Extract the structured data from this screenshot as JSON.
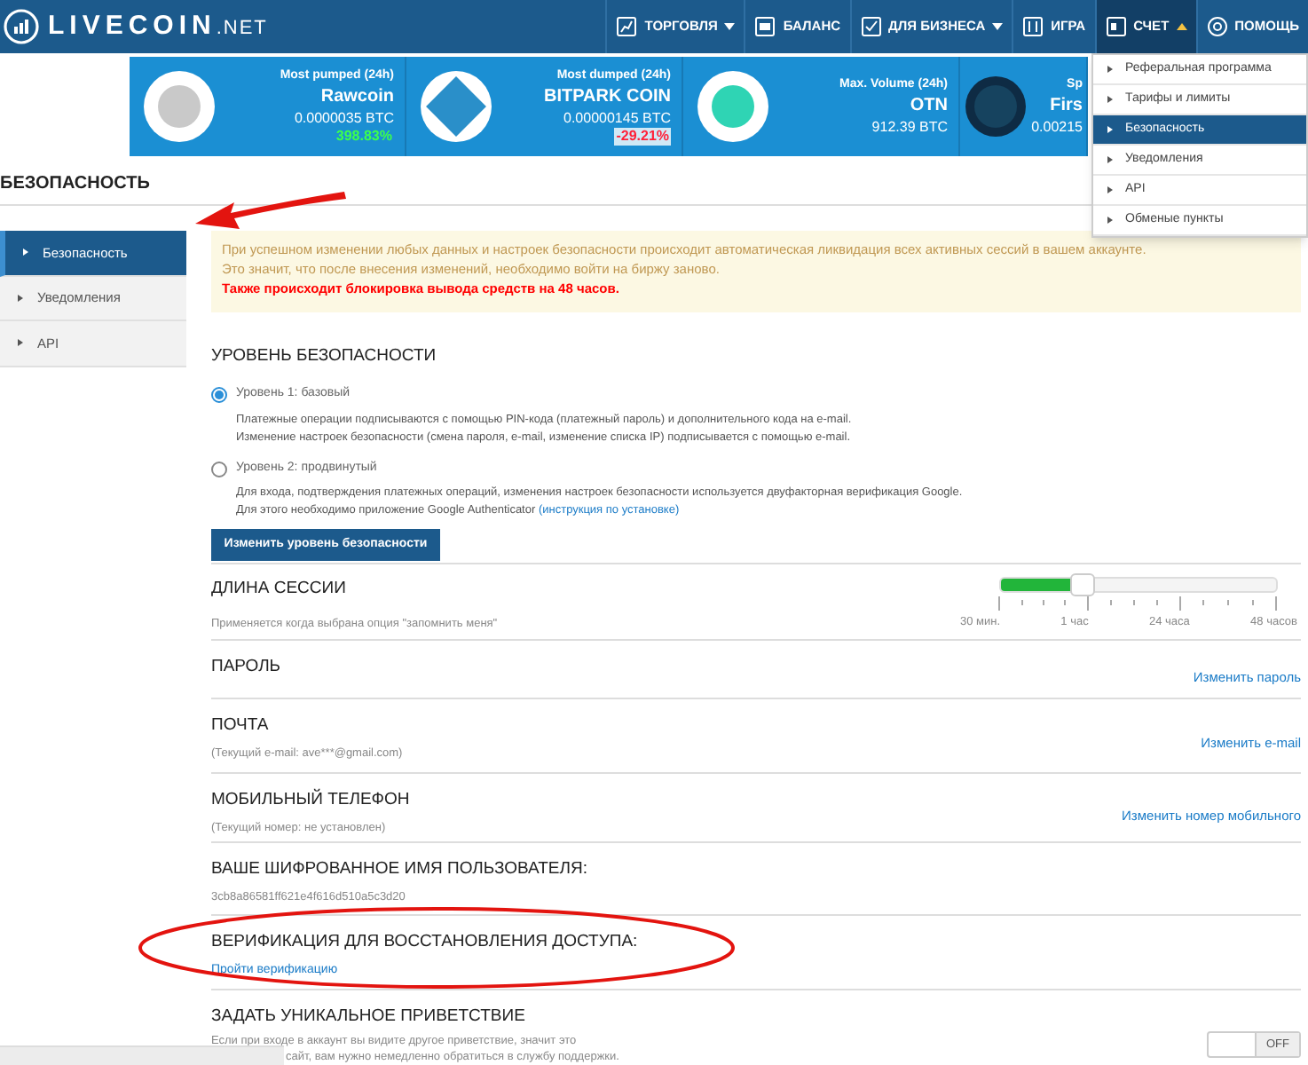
{
  "header": {
    "logo": "LIVECOIN",
    "logo_suffix": ".NET",
    "nav": [
      {
        "label": "ТОРГОВЛЯ",
        "caret": true,
        "selected": false
      },
      {
        "label": "БАЛАНС",
        "caret": false,
        "selected": false
      },
      {
        "label": "ДЛЯ БИЗНЕСА",
        "caret": true,
        "selected": false
      },
      {
        "label": "ИГРА",
        "caret": false,
        "selected": false
      },
      {
        "label": "СЧЕТ",
        "caret": true,
        "selected": true
      },
      {
        "label": "ПОМОЩЬ",
        "caret": false,
        "selected": false
      }
    ]
  },
  "tickers": [
    {
      "title": "Most pumped (24h)",
      "name": "Rawcoin",
      "price": "0.0000035 BTC",
      "change": "398.83%",
      "rising": true
    },
    {
      "title": "Most dumped (24h)",
      "name": "BITPARK COIN",
      "price": "0.00000145 BTC",
      "change": "-29.21%",
      "rising": false
    },
    {
      "title": "Max. Volume (24h)",
      "name": "OTN",
      "price": "912.39 BTC"
    },
    {
      "title": "Sp",
      "name": "Firs",
      "price": "0.00215"
    }
  ],
  "dropdown": {
    "items": [
      {
        "label": "Реферальная программа",
        "selected": false
      },
      {
        "label": "Тарифы и лимиты",
        "selected": false
      },
      {
        "label": "Безопасность",
        "selected": true
      },
      {
        "label": "Уведомления",
        "selected": false
      },
      {
        "label": "API",
        "selected": false
      },
      {
        "label": "Обменые пункты",
        "selected": false
      }
    ]
  },
  "page_title": "БЕЗОПАСНОСТЬ",
  "annotation_arrow": true,
  "sidebar": {
    "items": [
      {
        "label": "Безопасность",
        "selected": true
      },
      {
        "label": "Уведомления",
        "selected": false
      },
      {
        "label": "API",
        "selected": false
      }
    ]
  },
  "notice": {
    "lines": [
      "При успешном изменении любых данных и настроек безопасности происходит автоматическая ликвидация всех активных сессий в вашем аккаунте.",
      "Это значит, что после внесения изменений, необходимо войти на биржу заново."
    ],
    "warning": "Также происходит блокировка вывода средств на 48 часов."
  },
  "security_level": {
    "heading": "УРОВЕНЬ БЕЗОПАСНОСТИ",
    "options": [
      {
        "label": "Уровень 1: базовый",
        "selected": true,
        "lines": [
          "Платежные операции подписываются с помощью PIN-кода (платежный пароль) и дополнительного кода на e-mail.",
          "Изменение настроек безопасности (смена пароля, e-mail, изменение списка IP) подписывается с помощью e-mail."
        ]
      },
      {
        "label": "Уровень 2: продвинутый",
        "selected": false,
        "lines": [
          "Для входа, подтверждения платежных операций, изменения настроек безопасности используется двуфакторная верификация Google.",
          "Для этого необходимо приложение Google Authenticator"
        ],
        "link": "(инструкция по установке)"
      }
    ],
    "button": "Изменить уровень безопасности"
  },
  "session": {
    "heading": "ДЛИНА СЕССИИ",
    "subtitle": "Применяется когда выбрана опция \"запомнить меня\"",
    "level": 0.3,
    "ticks": [
      "30 мин.",
      "1 час",
      "24 часа",
      "48 часов"
    ]
  },
  "rows": [
    {
      "kind": "link",
      "heading": "ПАРОЛЬ",
      "action": "Изменить пароль"
    },
    {
      "kind": "link",
      "heading": "ПОЧТА",
      "subtitle": "(Текущий e-mail: ave***@gmail.com)",
      "action": "Изменить e-mail"
    },
    {
      "kind": "link",
      "heading": "МОБИЛЬНЫЙ ТЕЛЕФОН",
      "subtitle": "(Текущий номер: не установлен)",
      "action": "Изменить номер мобильного"
    },
    {
      "kind": "text",
      "heading": "ВАШЕ ШИФРОВАННОЕ ИМЯ ПОЛЬЗОВАТЕЛЯ:",
      "subtitle": "3cb8a86581ff621e4f616d510a5c3d20"
    },
    {
      "kind": "sublink",
      "heading": "ВЕРИФИКАЦИЯ ДЛЯ ВОССТАНОВЛЕНИЯ ДОСТУПА:",
      "link": "Пройти верификацию",
      "annotated": true
    },
    {
      "kind": "toggle",
      "heading": "ЗАДАТЬ УНИКАЛЬНОЕ ПРИВЕТСТВИЕ",
      "lines": [
        "Если при входе в аккаунт вы видите другое приветствие, значит это",
        "сайт, вам нужно немедленно обратиться в службу поддержки."
      ],
      "on": false,
      "toggle_label": "OFF"
    }
  ]
}
